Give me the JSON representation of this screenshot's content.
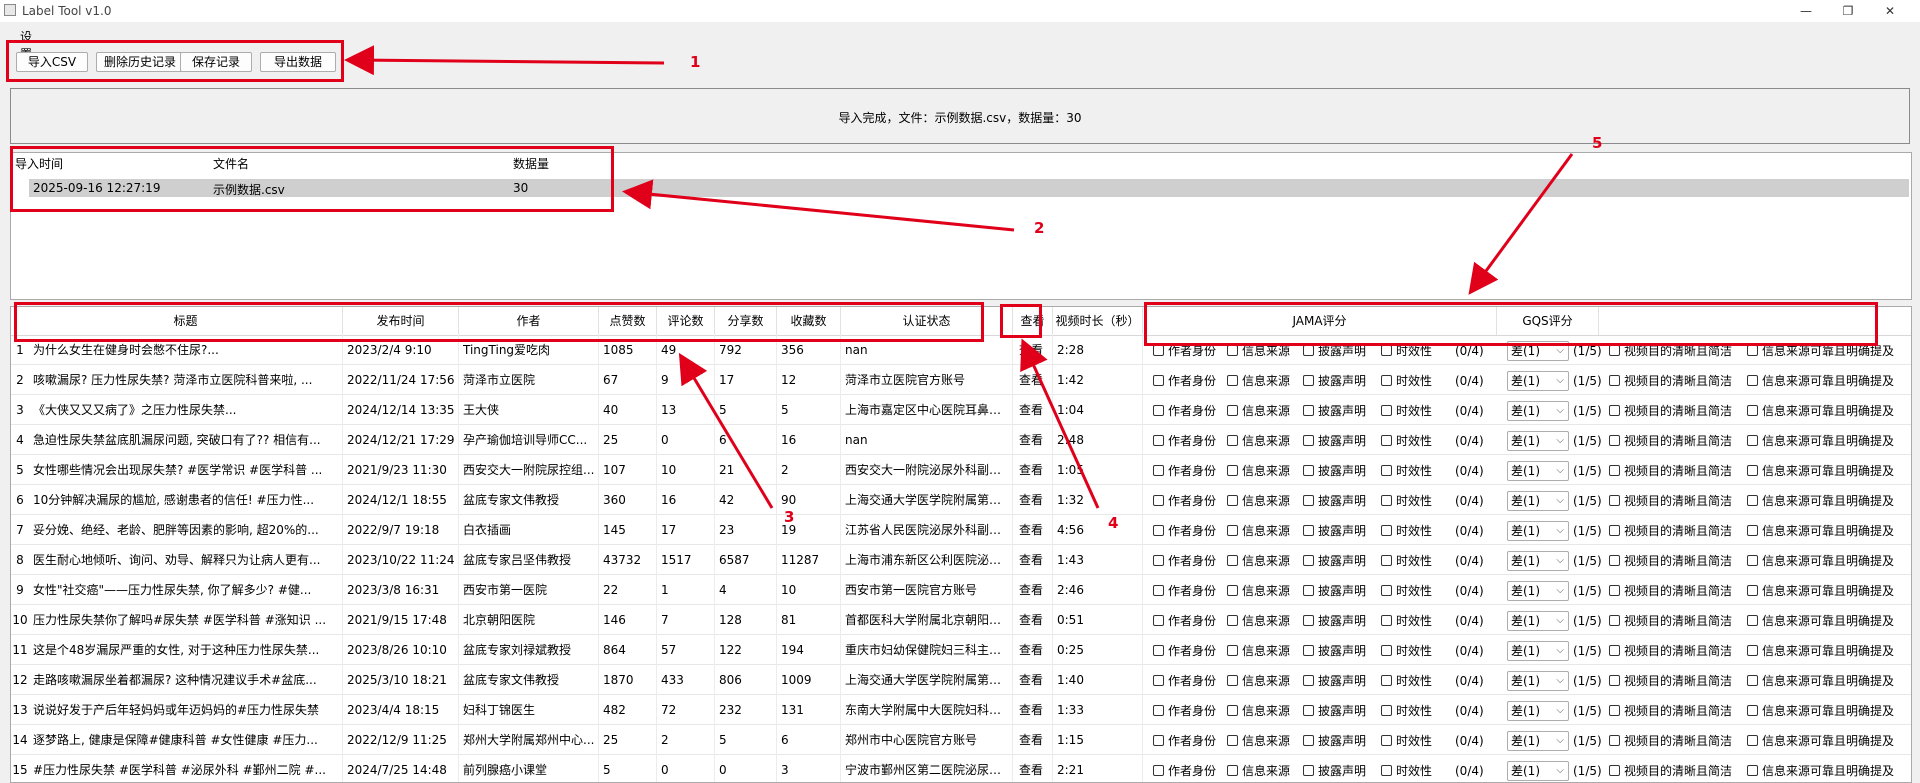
{
  "window": {
    "title": "Label Tool v1.0",
    "minimize": "—",
    "maximize": "❐",
    "close": "✕"
  },
  "menu": {
    "settings": "设置"
  },
  "toolbar": {
    "import_csv": "导入CSV",
    "delete_history": "删除历史记录",
    "save_record": "保存记录",
    "export_data": "导出数据"
  },
  "status": {
    "text": "导入完成，文件：示例数据.csv，数据量：30"
  },
  "history": {
    "headers": [
      "导入时间",
      "文件名",
      "数据量"
    ],
    "row": [
      "2025-09-16 12:27:19",
      "示例数据.csv",
      "30"
    ]
  },
  "table": {
    "headers": {
      "title": "标题",
      "publish_time": "发布时间",
      "author": "作者",
      "likes": "点赞数",
      "comments": "评论数",
      "shares": "分享数",
      "favorites": "收藏数",
      "verified": "认证状态",
      "view": "查看",
      "duration": "视频时长（秒）",
      "jama": "JAMA评分",
      "gqs": "GQS评分"
    },
    "view_label": "查看",
    "jama_options": [
      "作者身份",
      "信息来源",
      "披露声明",
      "时效性"
    ],
    "jama_score": "(0/4)",
    "gqs_value": "差(1)",
    "gqs_score": "(1/5)",
    "extra_checks": [
      "视频目的清晰且简洁",
      "信息来源可靠且明确提及"
    ],
    "rows": [
      {
        "n": "1",
        "title": "为什么女生在健身时会憋不住尿?...",
        "time": "2023/2/4 9:10",
        "author": "TingTing爱吃肉",
        "likes": "1085",
        "comments": "49",
        "shares": "792",
        "fav": "356",
        "verified": "nan",
        "duration": "2:28"
      },
      {
        "n": "2",
        "title": "咳嗽漏尿? 压力性尿失禁? 菏泽市立医院科普来啦, ...",
        "time": "2022/11/24 17:56",
        "author": "菏泽市立医院",
        "likes": "67",
        "comments": "9",
        "shares": "17",
        "fav": "12",
        "verified": "菏泽市立医院官方账号",
        "duration": "1:42"
      },
      {
        "n": "3",
        "title": "《大侠又又又病了》之压力性尿失禁...",
        "time": "2024/12/14 13:35",
        "author": "王大侠",
        "likes": "40",
        "comments": "13",
        "shares": "5",
        "fav": "5",
        "verified": "上海市嘉定区中心医院耳鼻咽...",
        "duration": "1:04"
      },
      {
        "n": "4",
        "title": "急迫性尿失禁盆底肌漏尿问题, 突破口有了?? 相信有...",
        "time": "2024/12/21 17:29",
        "author": "孕产瑜伽培训导师CC...",
        "likes": "25",
        "comments": "0",
        "shares": "6",
        "fav": "16",
        "verified": "nan",
        "duration": "2:48"
      },
      {
        "n": "5",
        "title": "女性哪些情况会出现尿失禁? #医学常识 #医学科普 ...",
        "time": "2021/9/23 11:30",
        "author": "西安交大一附院尿控组...",
        "likes": "107",
        "comments": "10",
        "shares": "21",
        "fav": "2",
        "verified": "西安交大一附院泌尿外科副主...",
        "duration": "1:05"
      },
      {
        "n": "6",
        "title": "10分钟解决漏尿的尴尬, 感谢患者的信任! #压力性...",
        "time": "2024/12/1 18:55",
        "author": "盆底专家文伟教授",
        "likes": "360",
        "comments": "16",
        "shares": "42",
        "fav": "90",
        "verified": "上海交通大学医学院附属第一...",
        "duration": "1:32"
      },
      {
        "n": "7",
        "title": "妥分娩、绝经、老龄、肥胖等因素的影响, 超20%的...",
        "time": "2022/9/7 19:18",
        "author": "白衣插画",
        "likes": "145",
        "comments": "17",
        "shares": "23",
        "fav": "19",
        "verified": "江苏省人民医院泌尿外科副主...",
        "duration": "4:56"
      },
      {
        "n": "8",
        "title": "医生耐心地倾听、询问、劝导、解释只为让病人更有...",
        "time": "2023/10/22 11:24",
        "author": "盆底专家吕坚伟教授",
        "likes": "43732",
        "comments": "1517",
        "shares": "6587",
        "fav": "11287",
        "verified": "上海市浦东新区公利医院泌尿...",
        "duration": "1:43"
      },
      {
        "n": "9",
        "title": "女性\"社交癌\"——压力性尿失禁, 你了解多少? #健...",
        "time": "2023/3/8 16:31",
        "author": "西安市第一医院",
        "likes": "22",
        "comments": "1",
        "shares": "4",
        "fav": "10",
        "verified": "西安市第一医院官方账号",
        "duration": "2:46"
      },
      {
        "n": "10",
        "title": "压力性尿失禁你了解吗#尿失禁 #医学科普 #涨知识 ...",
        "time": "2021/9/15 17:48",
        "author": "北京朝阳医院",
        "likes": "146",
        "comments": "7",
        "shares": "128",
        "fav": "81",
        "verified": "首都医科大学附属北京朝阳医...",
        "duration": "0:51"
      },
      {
        "n": "11",
        "title": "这是个48岁漏尿严重的女性, 对于这种压力性尿失禁...",
        "time": "2023/8/26 10:10",
        "author": "盆底专家刘禄斌教授",
        "likes": "864",
        "comments": "57",
        "shares": "122",
        "fav": "194",
        "verified": "重庆市妇幼保健院妇三科主任...",
        "duration": "0:25"
      },
      {
        "n": "12",
        "title": "走路咳嗽漏尿坐着都漏尿? 这种情况建议手术#盆底...",
        "time": "2025/3/10 18:21",
        "author": "盆底专家文伟教授",
        "likes": "1870",
        "comments": "433",
        "shares": "806",
        "fav": "1009",
        "verified": "上海交通大学医学院附属第一...",
        "duration": "1:40"
      },
      {
        "n": "13",
        "title": "说说好发于产后年轻妈妈或年迈妈妈的#压力性尿失禁",
        "time": "2023/4/4 18:15",
        "author": "妇科丁锦医生",
        "likes": "482",
        "comments": "72",
        "shares": "232",
        "fav": "131",
        "verified": "东南大学附属中大医院妇科副...",
        "duration": "1:33"
      },
      {
        "n": "14",
        "title": "逐梦路上, 健康是保障#健康科普 #女性健康 #压力...",
        "time": "2022/12/9 11:25",
        "author": "郑州大学附属郑州中心...",
        "likes": "25",
        "comments": "2",
        "shares": "5",
        "fav": "6",
        "verified": "郑州市中心医院官方账号",
        "duration": "1:15"
      },
      {
        "n": "15",
        "title": "#压力性尿失禁 #医学科普 #泌尿外科 #鄞州二院 #...",
        "time": "2024/7/25 14:48",
        "author": "前列腺癌小课堂",
        "likes": "5",
        "comments": "0",
        "shares": "0",
        "fav": "3",
        "verified": "宁波市鄞州区第二医院泌尿外...",
        "duration": "2:21"
      }
    ]
  },
  "annotations": {
    "labels": [
      "1",
      "2",
      "3",
      "4",
      "5"
    ],
    "color": "#e0001a"
  }
}
